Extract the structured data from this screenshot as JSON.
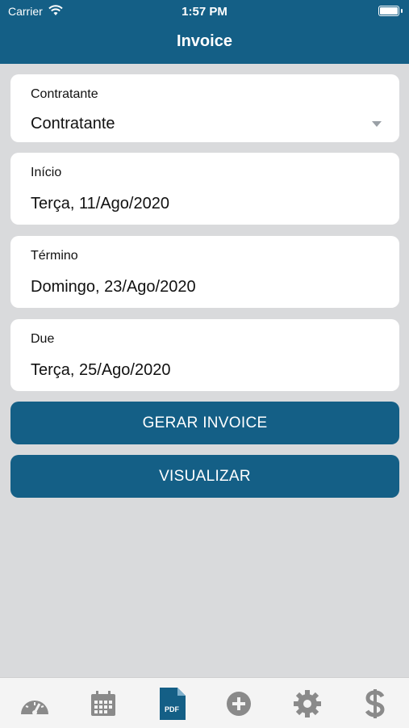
{
  "status_bar": {
    "carrier": "Carrier",
    "time": "1:57 PM"
  },
  "header": {
    "title": "Invoice"
  },
  "fields": [
    {
      "label": "Contratante",
      "value": "Contratante"
    },
    {
      "label": "Início",
      "value": "Terça, 11/Ago/2020"
    },
    {
      "label": "Término",
      "value": "Domingo, 23/Ago/2020"
    },
    {
      "label": "Due",
      "value": "Terça, 25/Ago/2020"
    }
  ],
  "buttons": {
    "generate": "GERAR INVOICE",
    "view": "VISUALIZAR"
  },
  "pdf_icon_text": "PDF",
  "tabs": [
    "dashboard-icon",
    "calendar-icon",
    "pdf-document-icon",
    "add-icon",
    "settings-icon",
    "dollar-icon"
  ],
  "colors": {
    "primary": "#145f86",
    "background": "#d9dadc",
    "tab_inactive": "#8a8a8a"
  }
}
